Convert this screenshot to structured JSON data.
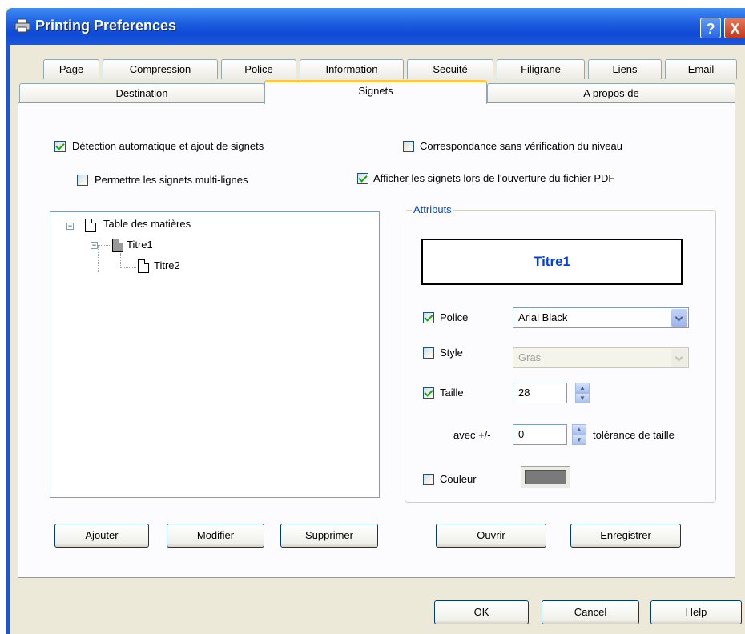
{
  "window": {
    "title": "Printing Preferences"
  },
  "titlebar_buttons": {
    "help": "?",
    "close": "X"
  },
  "tabs_row1": [
    "Page",
    "Compression",
    "Police",
    "Information",
    "Secuité",
    "Filigrane",
    "Liens",
    "Email"
  ],
  "tabs_row2": [
    "Destination",
    "Signets",
    "A propos de"
  ],
  "active_tab": "Signets",
  "options": {
    "auto_detect": {
      "label": "Détection automatique et ajout de signets",
      "checked": true
    },
    "multiline": {
      "label": "Permettre les signets multi-lignes",
      "checked": false
    },
    "no_level_check": {
      "label": "Correspondance sans vérification du niveau",
      "checked": false
    },
    "show_on_open": {
      "label": "Afficher les signets lors de l'ouverture du fichier PDF",
      "checked": true
    }
  },
  "tree": {
    "root": "Table des matières",
    "child1": "Titre1",
    "child2": "Titre2"
  },
  "attributes": {
    "group_title": "Attributs",
    "preview_text": "Titre1",
    "police": {
      "label": "Police",
      "checked": true,
      "value": "Arial Black"
    },
    "style": {
      "label": "Style",
      "checked": false,
      "value": "Gras"
    },
    "taille": {
      "label": "Taille",
      "checked": true,
      "value": "28"
    },
    "tolerance": {
      "prefix": "avec +/-",
      "value": "0",
      "suffix": "tolérance de taille"
    },
    "couleur": {
      "label": "Couleur",
      "checked": false,
      "swatch_color": "#7a7a7a"
    }
  },
  "buttons": {
    "ajouter": "Ajouter",
    "modifier": "Modifier",
    "supprimer": "Supprimer",
    "ouvrir": "Ouvrir",
    "enregistrer": "Enregistrer",
    "ok": "OK",
    "cancel": "Cancel",
    "help": "Help"
  },
  "colors": {
    "titlebar": "#1f5fe0",
    "active_tab_accent": "#ffc83c",
    "group_title": "#0046d5",
    "preview_text": "#0040e0"
  }
}
